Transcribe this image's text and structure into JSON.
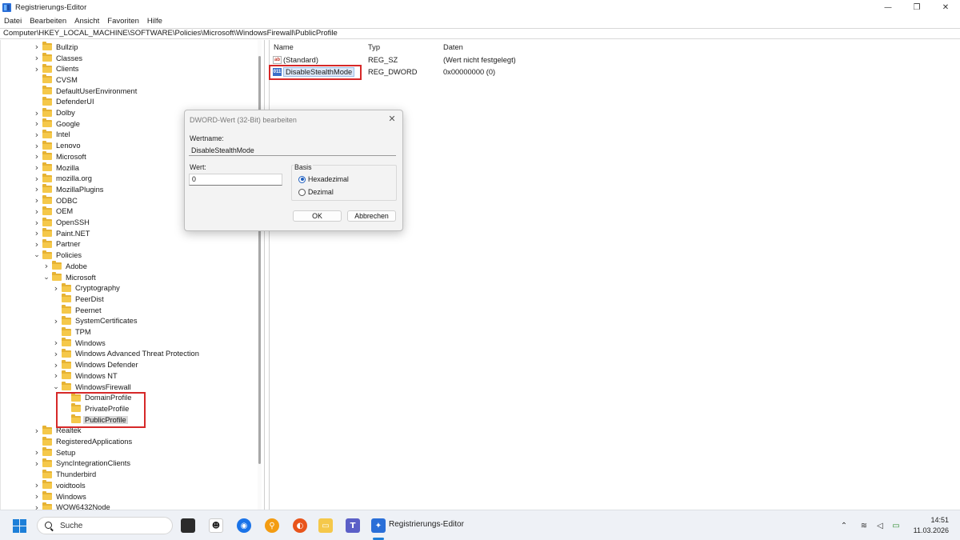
{
  "window": {
    "title": "Registrierungs-Editor",
    "minimize": "—",
    "maximize": "❐",
    "close": "✕"
  },
  "menu": [
    "Datei",
    "Bearbeiten",
    "Ansicht",
    "Favoriten",
    "Hilfe"
  ],
  "address": "Computer\\HKEY_LOCAL_MACHINE\\SOFTWARE\\Policies\\Microsoft\\WindowsFirewall\\PublicProfile",
  "tree": [
    {
      "label": "Bullzip",
      "level": 0,
      "expander": "collapsed"
    },
    {
      "label": "Classes",
      "level": 0,
      "expander": "collapsed"
    },
    {
      "label": "Clients",
      "level": 0,
      "expander": "collapsed"
    },
    {
      "label": "CVSM",
      "level": 0,
      "expander": "none"
    },
    {
      "label": "DefaultUserEnvironment",
      "level": 0,
      "expander": "none"
    },
    {
      "label": "DefenderUI",
      "level": 0,
      "expander": "none"
    },
    {
      "label": "Dolby",
      "level": 0,
      "expander": "collapsed"
    },
    {
      "label": "Google",
      "level": 0,
      "expander": "collapsed"
    },
    {
      "label": "Intel",
      "level": 0,
      "expander": "collapsed"
    },
    {
      "label": "Lenovo",
      "level": 0,
      "expander": "collapsed"
    },
    {
      "label": "Microsoft",
      "level": 0,
      "expander": "collapsed"
    },
    {
      "label": "Mozilla",
      "level": 0,
      "expander": "collapsed"
    },
    {
      "label": "mozilla.org",
      "level": 0,
      "expander": "collapsed"
    },
    {
      "label": "MozillaPlugins",
      "level": 0,
      "expander": "collapsed"
    },
    {
      "label": "ODBC",
      "level": 0,
      "expander": "collapsed"
    },
    {
      "label": "OEM",
      "level": 0,
      "expander": "collapsed"
    },
    {
      "label": "OpenSSH",
      "level": 0,
      "expander": "collapsed"
    },
    {
      "label": "Paint.NET",
      "level": 0,
      "expander": "collapsed"
    },
    {
      "label": "Partner",
      "level": 0,
      "expander": "collapsed"
    },
    {
      "label": "Policies",
      "level": 0,
      "expander": "expanded"
    },
    {
      "label": "Adobe",
      "level": 1,
      "expander": "collapsed"
    },
    {
      "label": "Microsoft",
      "level": 1,
      "expander": "expanded"
    },
    {
      "label": "Cryptography",
      "level": 2,
      "expander": "collapsed"
    },
    {
      "label": "PeerDist",
      "level": 2,
      "expander": "none"
    },
    {
      "label": "Peernet",
      "level": 2,
      "expander": "none"
    },
    {
      "label": "SystemCertificates",
      "level": 2,
      "expander": "collapsed"
    },
    {
      "label": "TPM",
      "level": 2,
      "expander": "none"
    },
    {
      "label": "Windows",
      "level": 2,
      "expander": "collapsed"
    },
    {
      "label": "Windows Advanced Threat Protection",
      "level": 2,
      "expander": "collapsed"
    },
    {
      "label": "Windows Defender",
      "level": 2,
      "expander": "collapsed"
    },
    {
      "label": "Windows NT",
      "level": 2,
      "expander": "collapsed"
    },
    {
      "label": "WindowsFirewall",
      "level": 2,
      "expander": "expanded"
    },
    {
      "label": "DomainProfile",
      "level": 3,
      "expander": "none"
    },
    {
      "label": "PrivateProfile",
      "level": 3,
      "expander": "none"
    },
    {
      "label": "PublicProfile",
      "level": 3,
      "expander": "none",
      "selected": true
    },
    {
      "label": "Realtek",
      "level": 0,
      "expander": "collapsed"
    },
    {
      "label": "RegisteredApplications",
      "level": 0,
      "expander": "none"
    },
    {
      "label": "Setup",
      "level": 0,
      "expander": "collapsed"
    },
    {
      "label": "SyncIntegrationClients",
      "level": 0,
      "expander": "collapsed"
    },
    {
      "label": "Thunderbird",
      "level": 0,
      "expander": "none"
    },
    {
      "label": "voidtools",
      "level": 0,
      "expander": "collapsed"
    },
    {
      "label": "Windows",
      "level": 0,
      "expander": "collapsed"
    },
    {
      "label": "WOW6432Node",
      "level": 0,
      "expander": "collapsed"
    }
  ],
  "list": {
    "columns": {
      "name": "Name",
      "type": "Typ",
      "data": "Daten"
    },
    "rows": [
      {
        "icon": "string-value-icon",
        "icon_text": "ab",
        "name": "(Standard)",
        "type": "REG_SZ",
        "data": "(Wert nicht festgelegt)"
      },
      {
        "icon": "dword-value-icon",
        "icon_text": "011",
        "name": "DisableStealthMode",
        "type": "REG_DWORD",
        "data": "0x00000000 (0)"
      }
    ]
  },
  "dialog": {
    "title": "DWORD-Wert (32-Bit) bearbeiten",
    "close": "✕",
    "name_label": "Wertname:",
    "name_value": "DisableStealthMode",
    "value_label": "Wert:",
    "value": "0",
    "base_label": "Basis",
    "radio_hex": "Hexadezimal",
    "radio_dec": "Dezimal",
    "selected_base": "Hexadezimal",
    "ok": "OK",
    "cancel": "Abbrechen"
  },
  "taskbar": {
    "search_placeholder": "Suche",
    "active_app": "Registrierungs-Editor",
    "time": "14:51",
    "date": "11.03.2026"
  },
  "colors": {
    "highlight": "#d62828",
    "accent": "#1d7fd8",
    "selection": "#d9d9d9"
  }
}
